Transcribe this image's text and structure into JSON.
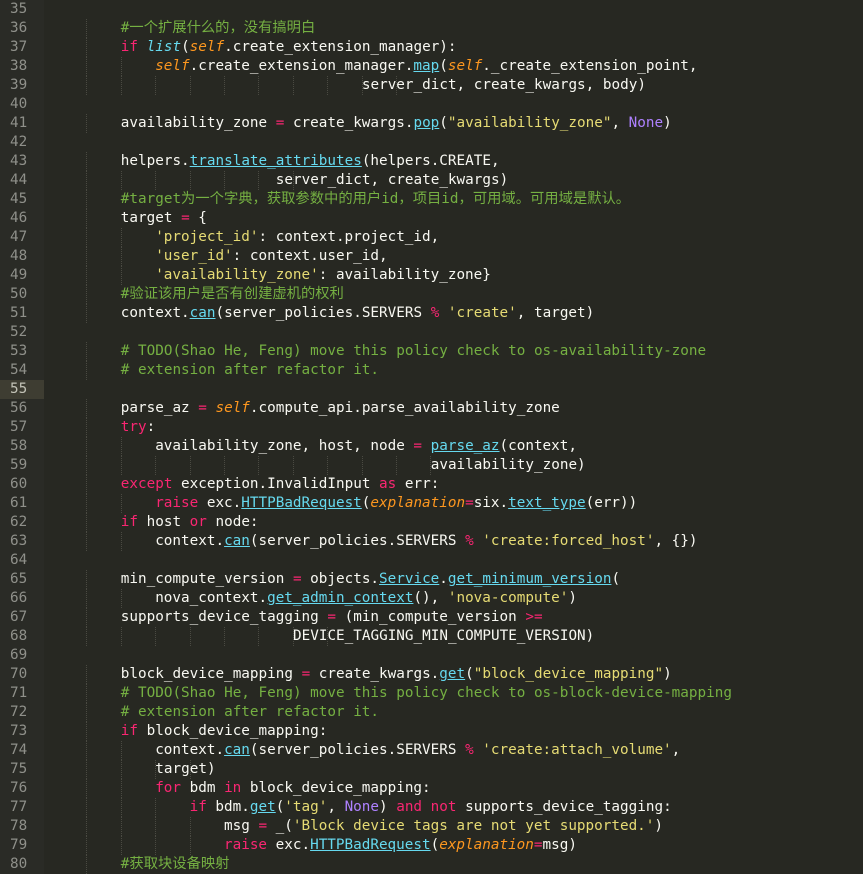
{
  "editor": {
    "theme": {
      "background": "#272822",
      "keyword": "#f92672",
      "function": "#66d9ef",
      "self": "#fd971f",
      "string": "#e6db74",
      "comment": "#75b042",
      "constant": "#ae81ff",
      "text": "#f8f8f2",
      "line_number": "#8f908a"
    },
    "current_line": 55,
    "lines": [
      {
        "n": "35",
        "indent": 0,
        "tokens": []
      },
      {
        "n": "36",
        "indent": 2,
        "tokens": [
          [
            "cm",
            "#一个扩展什么的，没有搞明白"
          ]
        ]
      },
      {
        "n": "37",
        "indent": 2,
        "tokens": [
          [
            "kw",
            "if "
          ],
          [
            "bi",
            "list"
          ],
          [
            "tx",
            "("
          ],
          [
            "sf",
            "self"
          ],
          [
            "tx",
            ".create_extension_manager):"
          ]
        ]
      },
      {
        "n": "38",
        "indent": 3,
        "tokens": [
          [
            "sf",
            "self"
          ],
          [
            "tx",
            ".create_extension_manager."
          ],
          [
            "fn",
            "map"
          ],
          [
            "tx",
            "("
          ],
          [
            "sf",
            "self"
          ],
          [
            "tx",
            "._create_extension_point,"
          ]
        ]
      },
      {
        "n": "39",
        "indent": 11,
        "pad": "                                    ",
        "tokens": [
          [
            "tx",
            "server_dict, create_kwargs, body)"
          ]
        ]
      },
      {
        "n": "40",
        "indent": 0,
        "tokens": []
      },
      {
        "n": "41",
        "indent": 2,
        "tokens": [
          [
            "tx",
            "availability_zone "
          ],
          [
            "op",
            "="
          ],
          [
            "tx",
            " create_kwargs."
          ],
          [
            "fn",
            "pop"
          ],
          [
            "tx",
            "("
          ],
          [
            "st",
            "\"availability_zone\""
          ],
          [
            "tx",
            ", "
          ],
          [
            "cn",
            "None"
          ],
          [
            "tx",
            ")"
          ]
        ]
      },
      {
        "n": "42",
        "indent": 0,
        "tokens": []
      },
      {
        "n": "43",
        "indent": 2,
        "tokens": [
          [
            "tx",
            "helpers."
          ],
          [
            "fn",
            "translate_attributes"
          ],
          [
            "tx",
            "(helpers.CREATE,"
          ]
        ]
      },
      {
        "n": "44",
        "indent": 8,
        "pad": "                          ",
        "tokens": [
          [
            "tx",
            "server_dict, create_kwargs)"
          ]
        ]
      },
      {
        "n": "45",
        "indent": 2,
        "tokens": [
          [
            "cm",
            "#target为一个字典，获取参数中的用户id，项目id，可用域。可用域是默认。"
          ]
        ]
      },
      {
        "n": "46",
        "indent": 2,
        "tokens": [
          [
            "tx",
            "target "
          ],
          [
            "op",
            "="
          ],
          [
            "tx",
            " {"
          ]
        ]
      },
      {
        "n": "47",
        "indent": 3,
        "tokens": [
          [
            "st",
            "'project_id'"
          ],
          [
            "tx",
            ": context.project_id,"
          ]
        ]
      },
      {
        "n": "48",
        "indent": 3,
        "tokens": [
          [
            "st",
            "'user_id'"
          ],
          [
            "tx",
            ": context.user_id,"
          ]
        ]
      },
      {
        "n": "49",
        "indent": 3,
        "tokens": [
          [
            "st",
            "'availability_zone'"
          ],
          [
            "tx",
            ": availability_zone}"
          ]
        ]
      },
      {
        "n": "50",
        "indent": 2,
        "tokens": [
          [
            "cm",
            "#验证该用户是否有创建虚机的权利"
          ]
        ]
      },
      {
        "n": "51",
        "indent": 2,
        "tokens": [
          [
            "tx",
            "context."
          ],
          [
            "fn",
            "can"
          ],
          [
            "tx",
            "(server_policies.SERVERS "
          ],
          [
            "op",
            "%"
          ],
          [
            "tx",
            " "
          ],
          [
            "st",
            "'create'"
          ],
          [
            "tx",
            ", target)"
          ]
        ]
      },
      {
        "n": "52",
        "indent": 0,
        "tokens": []
      },
      {
        "n": "53",
        "indent": 2,
        "tokens": [
          [
            "cm",
            "# TODO(Shao He, Feng) move this policy check to os-availability-zone"
          ]
        ]
      },
      {
        "n": "54",
        "indent": 2,
        "tokens": [
          [
            "cm",
            "# extension after refactor it."
          ]
        ]
      },
      {
        "n": "55",
        "indent": 0,
        "tokens": []
      },
      {
        "n": "56",
        "indent": 2,
        "tokens": [
          [
            "tx",
            "parse_az "
          ],
          [
            "op",
            "="
          ],
          [
            "tx",
            " "
          ],
          [
            "sf",
            "self"
          ],
          [
            "tx",
            ".compute_api.parse_availability_zone"
          ]
        ]
      },
      {
        "n": "57",
        "indent": 2,
        "tokens": [
          [
            "kw",
            "try"
          ],
          [
            "tx",
            ":"
          ]
        ]
      },
      {
        "n": "58",
        "indent": 3,
        "tokens": [
          [
            "tx",
            "availability_zone, host, node "
          ],
          [
            "op",
            "="
          ],
          [
            "tx",
            " "
          ],
          [
            "fn",
            "parse_az"
          ],
          [
            "tx",
            "(context,"
          ]
        ]
      },
      {
        "n": "59",
        "indent": 12,
        "pad": "                                            ",
        "tokens": [
          [
            "tx",
            "availability_zone)"
          ]
        ]
      },
      {
        "n": "60",
        "indent": 2,
        "tokens": [
          [
            "kw",
            "except"
          ],
          [
            "tx",
            " exception.InvalidInput "
          ],
          [
            "kw",
            "as"
          ],
          [
            "tx",
            " err:"
          ]
        ]
      },
      {
        "n": "61",
        "indent": 3,
        "tokens": [
          [
            "kw",
            "raise"
          ],
          [
            "tx",
            " exc."
          ],
          [
            "fn",
            "HTTPBadRequest"
          ],
          [
            "tx",
            "("
          ],
          [
            "pa",
            "explanation"
          ],
          [
            "op",
            "="
          ],
          [
            "tx",
            "six."
          ],
          [
            "fn",
            "text_type"
          ],
          [
            "tx",
            "(err))"
          ]
        ]
      },
      {
        "n": "62",
        "indent": 2,
        "tokens": [
          [
            "kw",
            "if"
          ],
          [
            "tx",
            " host "
          ],
          [
            "kw",
            "or"
          ],
          [
            "tx",
            " node:"
          ]
        ]
      },
      {
        "n": "63",
        "indent": 3,
        "tokens": [
          [
            "tx",
            "context."
          ],
          [
            "fn",
            "can"
          ],
          [
            "tx",
            "(server_policies.SERVERS "
          ],
          [
            "op",
            "%"
          ],
          [
            "tx",
            " "
          ],
          [
            "st",
            "'create:forced_host'"
          ],
          [
            "tx",
            ", {})"
          ]
        ]
      },
      {
        "n": "64",
        "indent": 0,
        "tokens": []
      },
      {
        "n": "65",
        "indent": 2,
        "tokens": [
          [
            "tx",
            "min_compute_version "
          ],
          [
            "op",
            "="
          ],
          [
            "tx",
            " objects."
          ],
          [
            "fn",
            "Service"
          ],
          [
            "tx",
            "."
          ],
          [
            "fn",
            "get_minimum_version"
          ],
          [
            "tx",
            "("
          ]
        ]
      },
      {
        "n": "66",
        "indent": 3,
        "tokens": [
          [
            "tx",
            "nova_context."
          ],
          [
            "fn",
            "get_admin_context"
          ],
          [
            "tx",
            "(), "
          ],
          [
            "st",
            "'nova-compute'"
          ],
          [
            "tx",
            ")"
          ]
        ]
      },
      {
        "n": "67",
        "indent": 2,
        "tokens": [
          [
            "tx",
            "supports_device_tagging "
          ],
          [
            "op",
            "="
          ],
          [
            "tx",
            " (min_compute_version "
          ],
          [
            "op",
            ">="
          ]
        ]
      },
      {
        "n": "68",
        "indent": 9,
        "pad": "                            ",
        "tokens": [
          [
            "tx",
            "DEVICE_TAGGING_MIN_COMPUTE_VERSION)"
          ]
        ]
      },
      {
        "n": "69",
        "indent": 0,
        "tokens": []
      },
      {
        "n": "70",
        "indent": 2,
        "tokens": [
          [
            "tx",
            "block_device_mapping "
          ],
          [
            "op",
            "="
          ],
          [
            "tx",
            " create_kwargs."
          ],
          [
            "fn",
            "get"
          ],
          [
            "tx",
            "("
          ],
          [
            "st",
            "\"block_device_mapping\""
          ],
          [
            "tx",
            ")"
          ]
        ]
      },
      {
        "n": "71",
        "indent": 2,
        "tokens": [
          [
            "cm",
            "# TODO(Shao He, Feng) move this policy check to os-block-device-mapping"
          ]
        ]
      },
      {
        "n": "72",
        "indent": 2,
        "tokens": [
          [
            "cm",
            "# extension after refactor it."
          ]
        ]
      },
      {
        "n": "73",
        "indent": 2,
        "tokens": [
          [
            "kw",
            "if"
          ],
          [
            "tx",
            " block_device_mapping:"
          ]
        ]
      },
      {
        "n": "74",
        "indent": 3,
        "tokens": [
          [
            "tx",
            "context."
          ],
          [
            "fn",
            "can"
          ],
          [
            "tx",
            "(server_policies.SERVERS "
          ],
          [
            "op",
            "%"
          ],
          [
            "tx",
            " "
          ],
          [
            "st",
            "'create:attach_volume'"
          ],
          [
            "tx",
            ","
          ]
        ]
      },
      {
        "n": "75",
        "indent": 5,
        "pad": "            ",
        "tokens": [
          [
            "tx",
            "target)"
          ]
        ]
      },
      {
        "n": "76",
        "indent": 3,
        "tokens": [
          [
            "kw",
            "for"
          ],
          [
            "tx",
            " bdm "
          ],
          [
            "kw",
            "in"
          ],
          [
            "tx",
            " block_device_mapping:"
          ]
        ]
      },
      {
        "n": "77",
        "indent": 4,
        "tokens": [
          [
            "kw",
            "if"
          ],
          [
            "tx",
            " bdm."
          ],
          [
            "fn",
            "get"
          ],
          [
            "tx",
            "("
          ],
          [
            "st",
            "'tag'"
          ],
          [
            "tx",
            ", "
          ],
          [
            "cn",
            "None"
          ],
          [
            "tx",
            ") "
          ],
          [
            "kw",
            "and"
          ],
          [
            "tx",
            " "
          ],
          [
            "kw",
            "not"
          ],
          [
            "tx",
            " supports_device_tagging:"
          ]
        ]
      },
      {
        "n": "78",
        "indent": 5,
        "tokens": [
          [
            "tx",
            "msg "
          ],
          [
            "op",
            "="
          ],
          [
            "tx",
            " _("
          ],
          [
            "st",
            "'Block device tags are not yet supported.'"
          ],
          [
            "tx",
            ")"
          ]
        ]
      },
      {
        "n": "79",
        "indent": 5,
        "tokens": [
          [
            "kw",
            "raise"
          ],
          [
            "tx",
            " exc."
          ],
          [
            "fn",
            "HTTPBadRequest"
          ],
          [
            "tx",
            "("
          ],
          [
            "pa",
            "explanation"
          ],
          [
            "op",
            "="
          ],
          [
            "tx",
            "msg)"
          ]
        ]
      },
      {
        "n": "80",
        "indent": 2,
        "tokens": [
          [
            "cm",
            "#获取块设备映射"
          ]
        ]
      }
    ]
  }
}
